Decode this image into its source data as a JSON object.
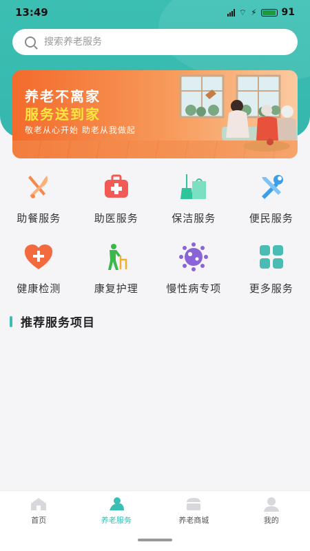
{
  "status": {
    "time": "13:49",
    "battery": "91",
    "network": "4G"
  },
  "search": {
    "placeholder": "搜索养老服务"
  },
  "banner": {
    "line1": "养老不离家",
    "line2": "服务送到家",
    "line3": "敬老从心开始  助老从我做起"
  },
  "services": [
    {
      "label": "助餐服务",
      "icon": "fork-knife-icon",
      "color": "#f7874a"
    },
    {
      "label": "助医服务",
      "icon": "medical-kit-icon",
      "color": "#f25a55"
    },
    {
      "label": "保洁服务",
      "icon": "broom-bag-icon",
      "color": "#2ec49c"
    },
    {
      "label": "便民服务",
      "icon": "wrench-screwdriver-icon",
      "color": "#3a9ee8"
    },
    {
      "label": "健康检测",
      "icon": "heart-plus-icon",
      "color": "#f26a3e"
    },
    {
      "label": "康复护理",
      "icon": "elderly-walker-icon",
      "color": "#3ab84a"
    },
    {
      "label": "慢性病专项",
      "icon": "virus-icon",
      "color": "#8a63d8"
    },
    {
      "label": "更多服务",
      "icon": "grid-icon",
      "color": "#4bbcb4"
    }
  ],
  "section": {
    "title": "推荐服务项目"
  },
  "tabs": [
    {
      "label": "首页",
      "icon": "home-icon",
      "active": false
    },
    {
      "label": "养老服务",
      "icon": "elder-service-icon",
      "active": true
    },
    {
      "label": "养老商城",
      "icon": "shop-icon",
      "active": false
    },
    {
      "label": "我的",
      "icon": "user-icon",
      "active": false
    }
  ],
  "colors": {
    "accent": "#3cbfb3",
    "banner": "#f36b2c",
    "highlight": "#ffe640"
  }
}
